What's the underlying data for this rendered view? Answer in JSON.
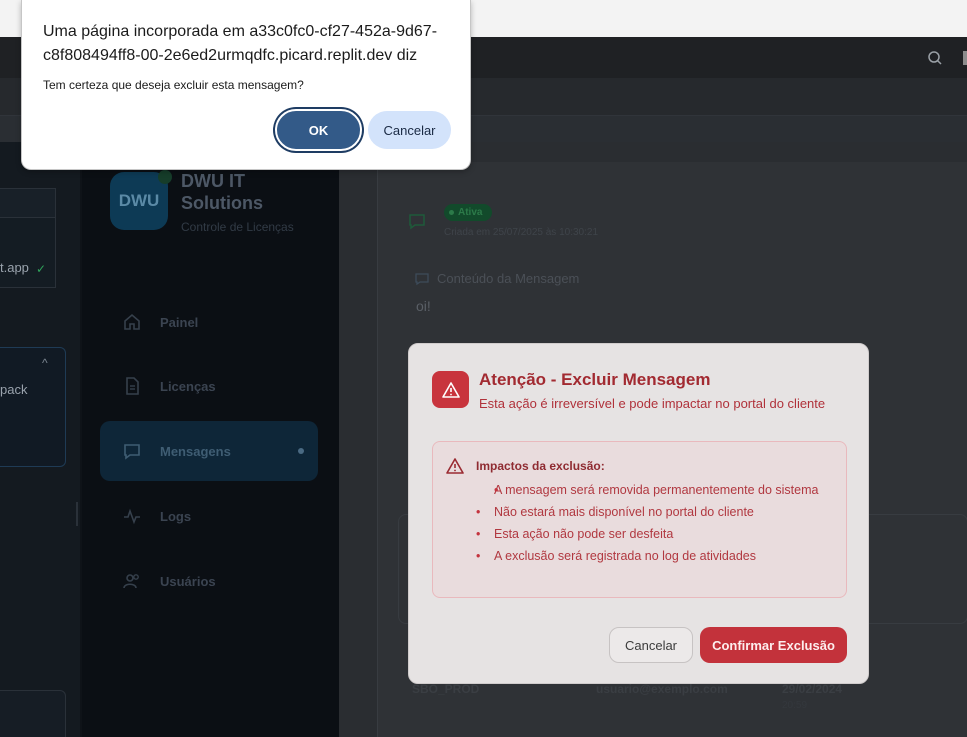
{
  "alert": {
    "title": "Uma página incorporada em a33c0fc0-cf27-452a-9d67-c8f808494ff8-00-2e6ed2urmqdfc.picard.replit.dev diz",
    "message": "Tem certeza que deseja excluir esta mensagem?",
    "ok_label": "OK",
    "cancel_label": "Cancelar"
  },
  "left_pane": {
    "app_suffix": "t.app",
    "pack_text": "pack"
  },
  "sidebar": {
    "logo_text": "DWU",
    "brand": "DWU IT Solutions",
    "subtitle": "Controle de Licenças",
    "items": [
      {
        "label": "Painel",
        "icon": "home-icon"
      },
      {
        "label": "Licenças",
        "icon": "document-icon"
      },
      {
        "label": "Mensagens",
        "icon": "message-icon",
        "active": true
      },
      {
        "label": "Logs",
        "icon": "activity-icon"
      },
      {
        "label": "Usuários",
        "icon": "users-icon"
      }
    ]
  },
  "message": {
    "status": "Ativa",
    "created": "Criada em 25/07/2025 às 10:30:21",
    "content_title": "Conteúdo da Mensagem",
    "content_body": "oi!"
  },
  "table_row": {
    "client": "SBO_PROD",
    "email": "usuario@exemplo.com",
    "date": "29/02/2024",
    "time": "20:59"
  },
  "modal": {
    "title": "Atenção - Excluir Mensagem",
    "subtitle": "Esta ação é irreversível e pode impactar no portal do cliente",
    "impacts_title": "Impactos da exclusão:",
    "impacts": [
      "A mensagem será removida permanentemente do sistema",
      "Não estará mais disponível no portal do cliente",
      "Esta ação não pode ser desfeita",
      "A exclusão será registrada no log de atividades"
    ],
    "cancel_label": "Cancelar",
    "confirm_label": "Confirmar Exclusão"
  },
  "colors": {
    "danger": "#c3323b",
    "alert_ok": "#335a88",
    "alert_cancel": "#d3e3fb"
  }
}
